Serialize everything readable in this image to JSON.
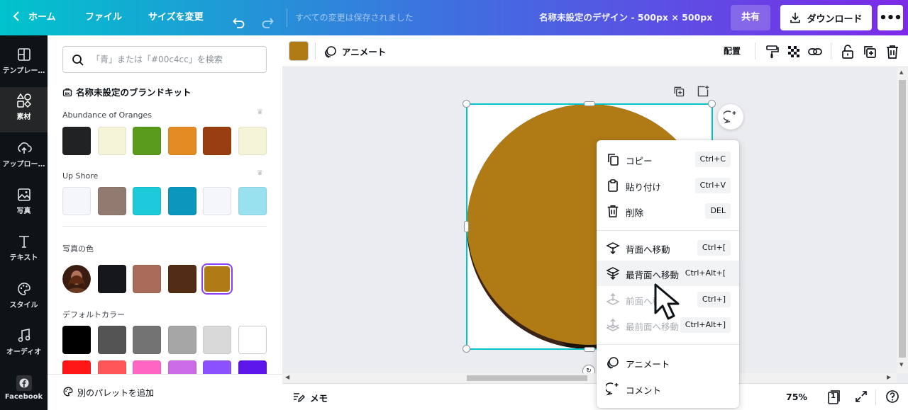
{
  "topbar": {
    "home_label": "ホーム",
    "file_label": "ファイル",
    "resize_label": "サイズを変更",
    "saved_status": "すべての変更は保存されました",
    "doc_title": "名称未設定のデザイン - 500px × 500px",
    "share_label": "共有",
    "download_label": "ダウンロード"
  },
  "rail": {
    "items": [
      {
        "label": "テンプレー…",
        "icon": "template-icon"
      },
      {
        "label": "素材",
        "icon": "elements-icon"
      },
      {
        "label": "アップロー…",
        "icon": "upload-icon"
      },
      {
        "label": "写真",
        "icon": "photo-icon"
      },
      {
        "label": "テキスト",
        "icon": "text-icon"
      },
      {
        "label": "スタイル",
        "icon": "palette-icon"
      },
      {
        "label": "オーディオ",
        "icon": "audio-icon"
      },
      {
        "label": "Facebook",
        "icon": "facebook-icon"
      }
    ]
  },
  "panel": {
    "search_placeholder": "「青」または「#00c4cc」を検索",
    "brand_kit_title": "名称未設定のブランドキット",
    "palettes": [
      {
        "name": "Abundance of Oranges",
        "colors": [
          "#212223",
          "#f6f4d8",
          "#5a9b1c",
          "#e48b23",
          "#983e10",
          "#f6f4d8"
        ]
      },
      {
        "name": "Up Shore",
        "colors": [
          "#f4f6fb",
          "#917b71",
          "#1ccad9",
          "#0a96bd",
          "#f5f6fa",
          "#99e1ee"
        ]
      }
    ],
    "photo_colors_title": "写真の色",
    "photo_colors": [
      "#16171b",
      "#a96b59",
      "#522c14",
      "#b07a15"
    ],
    "default_colors_title": "デフォルトカラー",
    "default_colors_row1": [
      "#000000",
      "#545454",
      "#737373",
      "#a6a6a6",
      "#d9d9d9",
      "#ffffff"
    ],
    "default_colors_row2": [
      "#ff1616",
      "#ff5757",
      "#ff66c4",
      "#cb6ce6",
      "#8c52ff",
      "#5e17eb"
    ],
    "add_palette_label": "別のパレットを追加"
  },
  "toolbar": {
    "current_color": "#b07a15",
    "animate_label": "アニメート",
    "arrange_label": "配置"
  },
  "context_menu": {
    "items": [
      {
        "label": "コピー",
        "shortcut": "Ctrl+C",
        "icon": "copy-icon",
        "enabled": true
      },
      {
        "label": "貼り付け",
        "shortcut": "Ctrl+V",
        "icon": "clipboard-icon",
        "enabled": true
      },
      {
        "label": "削除",
        "shortcut": "DEL",
        "icon": "trash-icon",
        "enabled": true
      },
      {
        "label": "背面へ移動",
        "shortcut": "Ctrl+[",
        "icon": "send-backward-icon",
        "enabled": true
      },
      {
        "label": "最背面へ移動",
        "shortcut": "Ctrl+Alt+[",
        "icon": "send-to-back-icon",
        "enabled": true
      },
      {
        "label": "前面へ移動",
        "shortcut": "Ctrl+]",
        "icon": "bring-forward-icon",
        "enabled": false
      },
      {
        "label": "最前面へ移動",
        "shortcut": "Ctrl+Alt+]",
        "icon": "bring-to-front-icon",
        "enabled": false
      },
      {
        "label": "アニメート",
        "shortcut": "",
        "icon": "animate-icon",
        "enabled": true
      },
      {
        "label": "コメント",
        "shortcut": "",
        "icon": "comment-icon",
        "enabled": true
      }
    ]
  },
  "bottombar": {
    "memo_label": "メモ",
    "zoom": "75%",
    "page_count": "1"
  }
}
